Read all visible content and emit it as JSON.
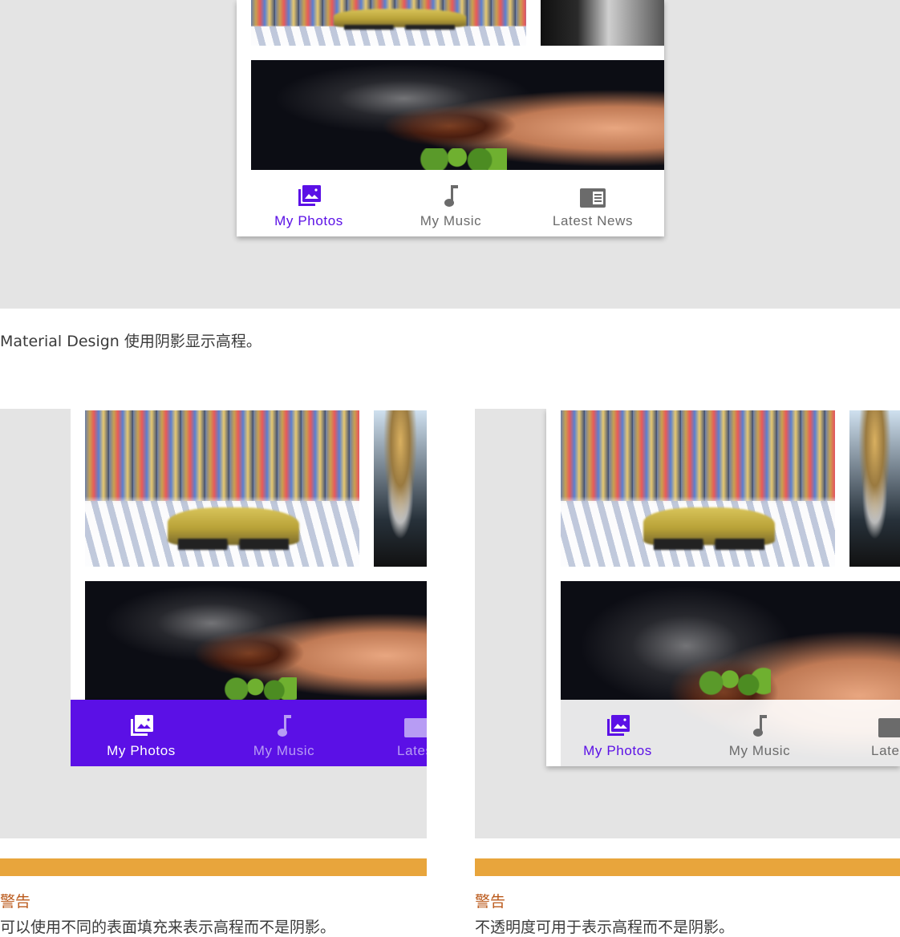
{
  "figure_top": {
    "nav": {
      "items": [
        {
          "label": "My Photos",
          "icon": "photo-library-icon",
          "selected": true
        },
        {
          "label": "My Music",
          "icon": "music-note-icon",
          "selected": false
        },
        {
          "label": "Latest News",
          "icon": "newspaper-icon",
          "selected": false
        }
      ]
    },
    "caption": "Material Design 使用阴影显示高程。"
  },
  "figure_left": {
    "nav": {
      "items": [
        {
          "label": "My Photos",
          "icon": "photo-library-icon",
          "selected": true
        },
        {
          "label": "My Music",
          "icon": "music-note-icon",
          "selected": false
        },
        {
          "label": "Latest",
          "icon": "newspaper-icon",
          "selected": false
        }
      ]
    },
    "warning_title": "警告",
    "warning_text": "可以使用不同的表面填充来表示高程而不是阴影。"
  },
  "figure_right": {
    "nav": {
      "items": [
        {
          "label": "My Photos",
          "icon": "photo-library-icon",
          "selected": true
        },
        {
          "label": "My Music",
          "icon": "music-note-icon",
          "selected": false
        },
        {
          "label": "Latest",
          "icon": "newspaper-icon",
          "selected": false
        }
      ]
    },
    "warning_title": "警告",
    "warning_text": "不透明度可用于表示高程而不是阴影。"
  },
  "colors": {
    "primary": "#5b10e6",
    "stage_bg": "#e4e4e4",
    "inactive": "#6b6b6b",
    "warning_bar": "#e8a53c",
    "warning_title": "#bb5a1c"
  }
}
